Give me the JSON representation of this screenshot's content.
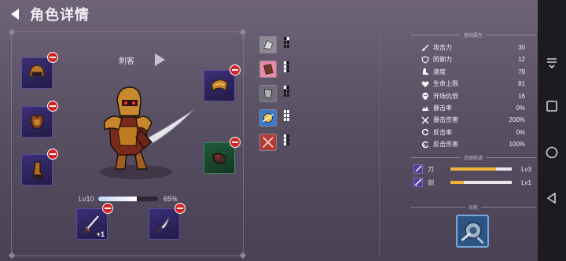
{
  "header": {
    "title": "角色详情",
    "back_icon": "back-arrow-icon"
  },
  "hero": {
    "class_name": "刺客",
    "level": "Lv10",
    "xp_percent": "65%",
    "xp_progress": 0.65
  },
  "equipment_slots": [
    {
      "slot": "helmet",
      "icon": "helmet-icon"
    },
    {
      "slot": "armor",
      "icon": "armor-icon"
    },
    {
      "slot": "boots",
      "icon": "boots-icon"
    },
    {
      "slot": "shoulder",
      "icon": "shoulder-armor-icon"
    },
    {
      "slot": "gloves",
      "icon": "gloves-icon"
    },
    {
      "slot": "sword",
      "icon": "sword-icon",
      "enhance": "+1"
    },
    {
      "slot": "knife",
      "icon": "knife-icon"
    }
  ],
  "skills": [
    {
      "icon": "skill-stone-icon",
      "pips": [
        0,
        1,
        0,
        0,
        0,
        0
      ]
    },
    {
      "icon": "skill-pink-icon",
      "pips": [
        1,
        0,
        1,
        0,
        1,
        0
      ]
    },
    {
      "icon": "skill-gray-icon",
      "pips": [
        1,
        0,
        0,
        0,
        0,
        0
      ]
    },
    {
      "icon": "skill-blue-icon",
      "pips": [
        1,
        1,
        1,
        1,
        1,
        1
      ]
    },
    {
      "icon": "skill-red-icon",
      "pips": [
        1,
        0,
        1,
        0,
        1,
        0
      ]
    }
  ],
  "base_stats": {
    "title": "基础属性",
    "items": [
      {
        "label": "攻击力",
        "value": "30",
        "icon": "sword-stat-icon"
      },
      {
        "label": "防御力",
        "value": "12",
        "icon": "shield-stat-icon"
      },
      {
        "label": "速度",
        "value": "79",
        "icon": "boot-stat-icon"
      },
      {
        "label": "生命上限",
        "value": "81",
        "icon": "heart-stat-icon"
      },
      {
        "label": "开场仇恨",
        "value": "16",
        "icon": "skull-stat-icon"
      },
      {
        "label": "暴击率",
        "value": "0%",
        "icon": "crit-rate-icon"
      },
      {
        "label": "暴击伤害",
        "value": "200%",
        "icon": "crit-damage-icon"
      },
      {
        "label": "反击率",
        "value": "0%",
        "icon": "counter-rate-icon"
      },
      {
        "label": "反击伤害",
        "value": "100%",
        "icon": "counter-damage-icon"
      }
    ]
  },
  "weapon_mastery": {
    "title": "武器精通",
    "items": [
      {
        "name": "刀",
        "level": "Lv3",
        "progress": 0.75
      },
      {
        "name": "剑",
        "level": "Lv1",
        "progress": 0.22
      }
    ]
  },
  "skill_section": {
    "title": "技能"
  },
  "colors": {
    "panel_border": "#968ca5",
    "slot_purple": "#3b2f78",
    "slot_green": "#215a3a",
    "xp_fill": "#ffffff",
    "mastery_fill": "#f0b33a",
    "remove_badge": "#d32525"
  }
}
